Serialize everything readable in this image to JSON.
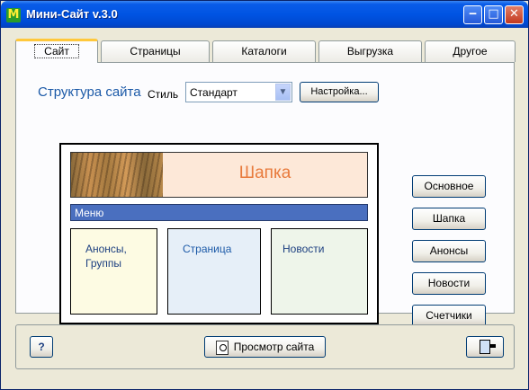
{
  "window": {
    "title": "Мини-Сайт v.3.0",
    "icon_letter": "M"
  },
  "tabs": [
    {
      "label": "Сайт"
    },
    {
      "label": "Страницы"
    },
    {
      "label": "Каталоги"
    },
    {
      "label": "Выгрузка"
    },
    {
      "label": "Другое"
    }
  ],
  "structure": {
    "title": "Структура сайта",
    "style_label": "Стиль",
    "style_value": "Стандарт",
    "settings_button": "Настройка..."
  },
  "preview": {
    "header_label": "Шапка",
    "menu_label": "Меню",
    "boxes": [
      {
        "line1": "Анонсы,",
        "line2": "Группы"
      },
      {
        "line1": "Страница",
        "line2": ""
      },
      {
        "line1": "Новости",
        "line2": ""
      }
    ]
  },
  "side_buttons": [
    "Основное",
    "Шапка",
    "Анонсы",
    "Новости",
    "Счетчики"
  ],
  "footer": {
    "help_label": "?",
    "preview_button": "Просмотр сайта"
  },
  "colors": {
    "title_blue": "#1c5aa8",
    "header_text": "#e87a3c",
    "menu_bar": "#4a6fbf"
  }
}
